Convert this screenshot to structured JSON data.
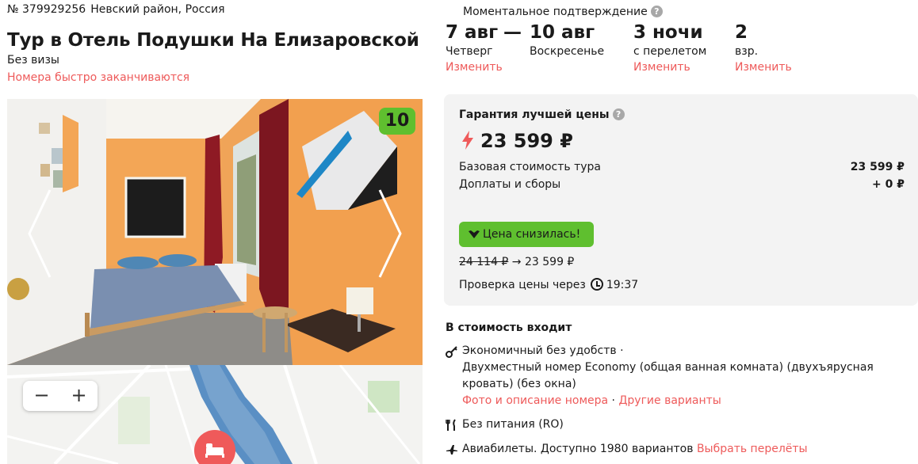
{
  "hotel": {
    "tour_number": "№ 379929256",
    "region": "Невский район, Россия",
    "title": "Тур в Отель Подушки На Елизаровской",
    "visa": "Без визы",
    "availability_warning": "Номера быстро заканчиваются",
    "rating": "10"
  },
  "map": {
    "zoom_out": "−",
    "zoom_in": "+"
  },
  "booking": {
    "instant_confirmation": "Моментальное подтверждение",
    "help_glyph": "?",
    "date_from": "7 авг",
    "dash": "—",
    "date_to": "10 авг",
    "weekday_from": "Четверг",
    "weekday_to": "Воскресенье",
    "change_dates": "Изменить",
    "nights": "3 ночи",
    "nights_note": "с перелетом",
    "change_nights": "Изменить",
    "guests": "2",
    "guests_note": "взр.",
    "change_guests": "Изменить"
  },
  "price": {
    "guarantee": "Гарантия лучшей цены",
    "total": "23 599 ₽",
    "base_label": "Базовая стоимость тура",
    "base_value": "23 599 ₽",
    "fees_label": "Доплаты и сборы",
    "fees_value": "+ 0 ₽",
    "drop_badge": "Цена снизилась!",
    "old_price": "24 114 ₽",
    "arrow": "→",
    "new_price": "23 599 ₽",
    "check_label": "Проверка цены через",
    "check_time": "19:37"
  },
  "includes": {
    "title": "В стоимость входит",
    "room": "Экономичный без удобств ·",
    "room_detail": "Двухместный номер Economy (общая ванная комната) (двухъярусная кровать) (без окна)",
    "photo_link": "Фото и описание номера",
    "separator": " · ",
    "other_link": "Другие варианты",
    "meal": "Без питания (RO)",
    "flights": "Авиабилеты. Доступно 1980 вариантов",
    "flights_link": "Выбрать перелёты"
  },
  "colors": {
    "accent_red": "#ee5a5a",
    "badge_green": "#5fbf2f",
    "card_bg": "#f3f3f3"
  }
}
